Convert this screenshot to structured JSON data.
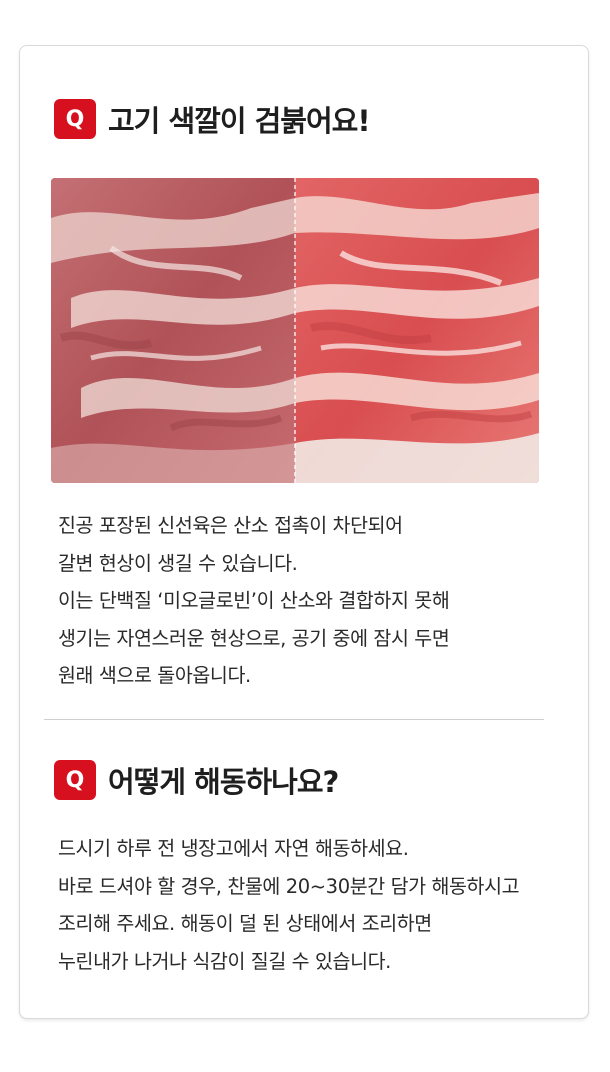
{
  "sections": [
    {
      "badge": "Q",
      "title": "고기 색깔이 검붉어요!",
      "lines": [
        "진공 포장된 신선육은 산소 접촉이 차단되어",
        "갈변 현상이 생길 수 있습니다.",
        "이는 단백질 ‘미오글로빈’이 산소와 결합하지 못해",
        "생기는 자연스러운 현상으로, 공기 중에 잠시 두면",
        "원래 색으로 돌아옵니다."
      ]
    },
    {
      "badge": "Q",
      "title": "어떻게 해동하나요?",
      "lines": [
        "드시기 하루 전 냉장고에서 자연 해동하세요.",
        "바로 드셔야 할 경우, 찬물에 20~30분간 담가 해동하시고",
        "조리해 주세요. 해동이 덜 된 상태에서 조리하면",
        "누린내가 나거나 식감이 질길 수 있습니다."
      ]
    }
  ],
  "colors": {
    "badge": "#d6101f",
    "border": "#d9d9d9",
    "divider": "#cfcfcf",
    "text": "#2a2a2a"
  },
  "photo": {
    "icon": "raw-pork-comparison-photo",
    "left_side": "browned-vacuum-packed-meat",
    "right_side": "bright-red-oxygenated-meat"
  }
}
